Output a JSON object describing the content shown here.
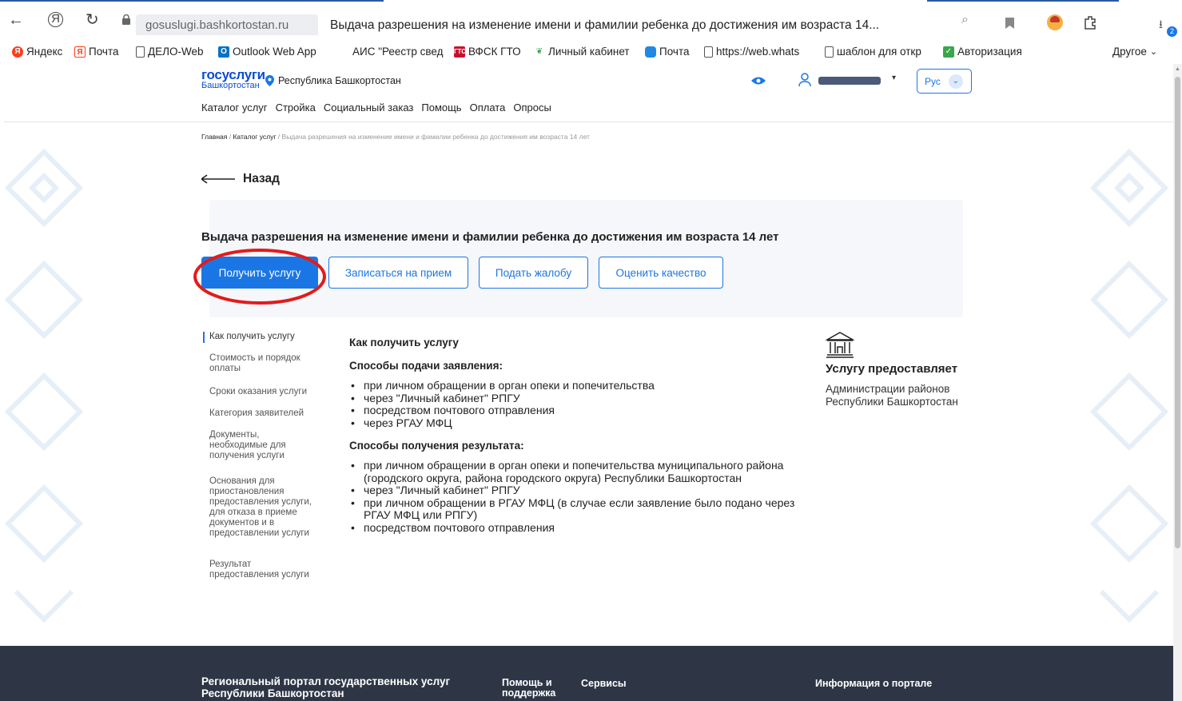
{
  "browser": {
    "domain": "gosuslugi.bashkortostan.ru",
    "title": "Выдача разрешения на изменение имени и фамилии ребенка до достижения им возраста 14...",
    "download_badge": "2"
  },
  "bookmarks": [
    {
      "label": "Яндекс",
      "icon": "yandex-icon",
      "color": "#fc3f1d"
    },
    {
      "label": "Почта",
      "icon": "yandex-mail-icon",
      "color": "#fc3f1d"
    },
    {
      "label": "ДЕЛО-Web",
      "icon": "page-icon",
      "color": "#555555"
    },
    {
      "label": "Outlook Web App",
      "icon": "outlook-icon",
      "color": "#0072c6"
    },
    {
      "label": "АИС \"Реестр свед",
      "icon": "blank-icon",
      "color": "#ffffff"
    },
    {
      "label": "ВФСК ГТО",
      "icon": "gto-icon",
      "color": "#c8102e"
    },
    {
      "label": "Личный кабинет",
      "icon": "sprout-icon",
      "color": "#3aa64c"
    },
    {
      "label": "Почта",
      "icon": "mail-icon",
      "color": "#1e88e5"
    },
    {
      "label": "https://web.whats",
      "icon": "page-icon",
      "color": "#555555"
    },
    {
      "label": "шаблон для откр",
      "icon": "page-icon",
      "color": "#555555"
    },
    {
      "label": "Авторизация",
      "icon": "auth-icon",
      "color": "#3aa64c"
    }
  ],
  "bookmarks_other": "Другое",
  "header": {
    "logo_main": "госуслуги",
    "logo_sub": "Башкортостан",
    "region": "Республика Башкортостан",
    "lang": "Рус",
    "nav": [
      "Каталог услуг",
      "Стройка",
      "Социальный заказ",
      "Помощь",
      "Оплата",
      "Опросы"
    ]
  },
  "breadcrumb": {
    "home": "Главная",
    "catalog": "Каталог услуг",
    "current": "Выдача разрешения на изменение имени и фамилии ребенка до достижения им возраста 14 лет"
  },
  "back_label": "Назад",
  "service": {
    "title": "Выдача разрешения на изменение имени и фамилии ребенка до достижения им возраста 14 лет",
    "buttons": {
      "primary": "Получить услугу",
      "appointment": "Записаться на прием",
      "complaint": "Подать жалобу",
      "rate": "Оценить качество"
    }
  },
  "sidebar": [
    "Как получить услугу",
    "Стоимость и порядок оплаты",
    "Сроки оказания услуги",
    "Категория заявителей",
    "Документы, необходимые для получения услуги",
    "Основания для приостановления предоставления услуги, для отказа в приеме документов и в предоставлении услуги",
    "Результат предоставления услуги"
  ],
  "content": {
    "heading": "Как получить услугу",
    "submit_heading": "Способы подачи заявления:",
    "submit_items": [
      "при личном обращении в орган опеки и попечительства",
      "через \"Личный кабинет\" РПГУ",
      "посредством почтового отправления",
      "через РГАУ МФЦ"
    ],
    "result_heading": "Способы получения результата:",
    "result_items": [
      "при личном обращении в орган опеки и попечительства муниципального района  (городского округа, района городского округа) Республики Башкортостан",
      "через \"Личный кабинет\" РПГУ",
      "при личном обращении в РГАУ МФЦ (в случае если заявление было подано через РГАУ МФЦ или РПГУ)",
      "посредством почтового отправления"
    ]
  },
  "provider": {
    "heading": "Услугу предоставляет",
    "text": "Администрации районов Республики Башкортостан"
  },
  "footer": {
    "portal": "Региональный портал государственных услуг Республики Башкортостан",
    "help": "Помощь и поддержка",
    "services": "Сервисы",
    "info": "Информация о портале"
  },
  "colors": {
    "accent": "#1b76e5",
    "annotation": "#e31b1b",
    "footer_bg": "#2e3646"
  }
}
